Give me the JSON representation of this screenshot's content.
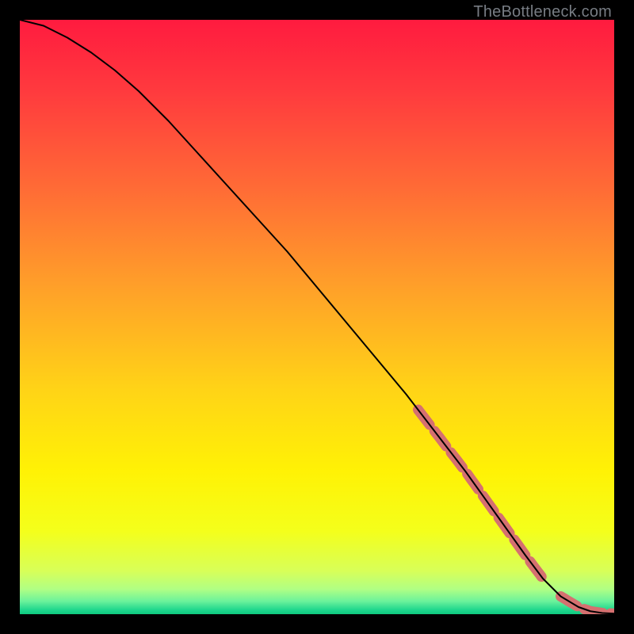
{
  "watermark": "TheBottleneck.com",
  "chart_data": {
    "type": "line",
    "title": "",
    "xlabel": "",
    "ylabel": "",
    "xlim": [
      0,
      100
    ],
    "ylim": [
      0,
      100
    ],
    "grid": false,
    "legend": false,
    "series": [
      {
        "name": "bottleneck-curve",
        "x": [
          0,
          4,
          8,
          12,
          16,
          20,
          25,
          30,
          35,
          40,
          45,
          50,
          55,
          60,
          65,
          70,
          75,
          80,
          85,
          88,
          91,
          94,
          96,
          98,
          100
        ],
        "values": [
          100,
          99,
          97,
          94.5,
          91.5,
          88,
          83,
          77.5,
          72,
          66.5,
          61,
          55,
          49,
          43,
          37,
          30.5,
          24,
          17,
          10,
          6,
          3,
          1.2,
          0.5,
          0.2,
          0.1
        ]
      }
    ],
    "highlight_segments": [
      {
        "from_x": 67,
        "to_x": 88
      },
      {
        "from_x": 91,
        "to_x": 100
      }
    ],
    "colors": {
      "curve": "#000000",
      "highlight": "#d57070",
      "gradient_stops": [
        {
          "offset": 0.0,
          "color": "#ff1b3f"
        },
        {
          "offset": 0.12,
          "color": "#ff3a3e"
        },
        {
          "offset": 0.28,
          "color": "#ff6a36"
        },
        {
          "offset": 0.45,
          "color": "#ffa029"
        },
        {
          "offset": 0.62,
          "color": "#ffd317"
        },
        {
          "offset": 0.76,
          "color": "#fff205"
        },
        {
          "offset": 0.86,
          "color": "#f4ff1b"
        },
        {
          "offset": 0.927,
          "color": "#d8ff58"
        },
        {
          "offset": 0.958,
          "color": "#b0ff84"
        },
        {
          "offset": 0.978,
          "color": "#6cf29b"
        },
        {
          "offset": 0.992,
          "color": "#22d88e"
        },
        {
          "offset": 1.0,
          "color": "#0ec97f"
        }
      ]
    }
  }
}
